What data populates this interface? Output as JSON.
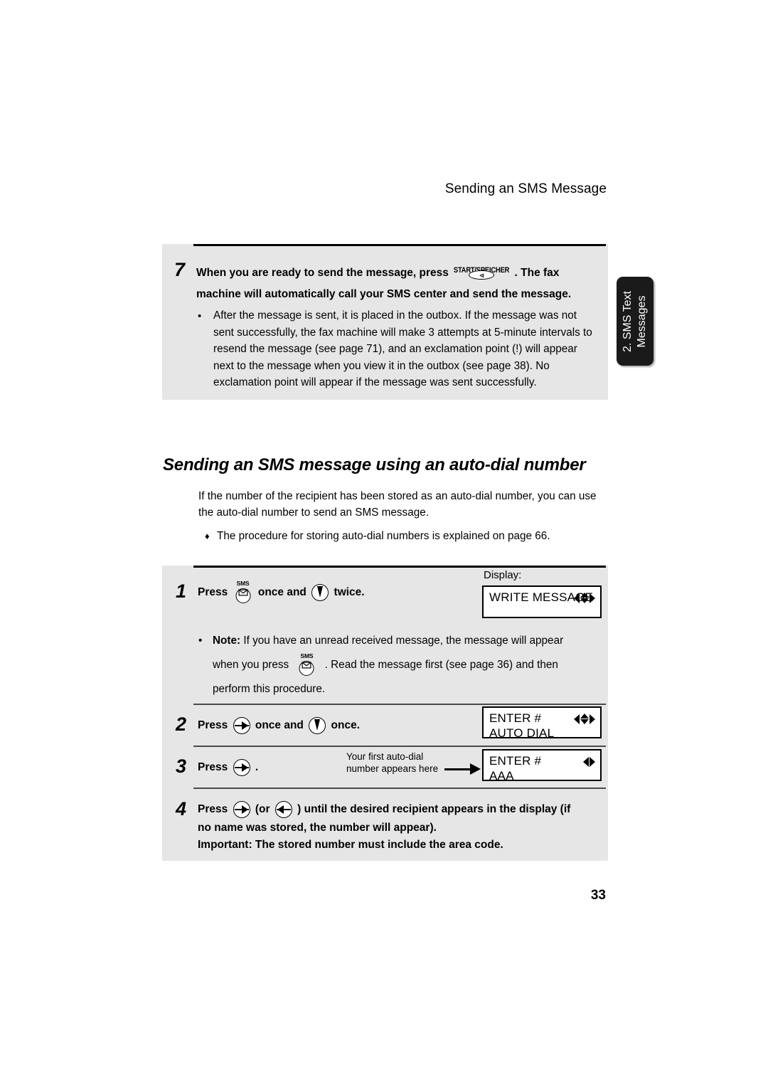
{
  "header": {
    "running_title": "Sending an SMS Message"
  },
  "side_tab": {
    "line1": "2. SMS Text",
    "line2": "Messages"
  },
  "step7": {
    "number": "7",
    "text_before_key": "When you are ready to send the message, press",
    "key_label": "START/SPEICHER",
    "text_after_key": ". The fax machine will automatically call your SMS center and send the message.",
    "bullet": "After the message is sent, it is placed in the outbox. If the message was not sent successfully, the fax machine will make 3 attempts at 5-minute intervals to resend the message (see page 71), and an exclamation point (!) will appear next to the message when you view it in the outbox (see page 38). No exclamation point will appear if the message was sent successfully.",
    "bullet_marker": "•"
  },
  "section": {
    "heading": "Sending an SMS message using an auto-dial number",
    "intro": "If the number of the recipient has been stored as an auto-dial number, you can use the auto-dial number to send an SMS message.",
    "diamond_marker": "♦",
    "diamond_note": "The procedure for storing auto-dial numbers is explained on page 66."
  },
  "display": {
    "label": "Display:"
  },
  "steps": [
    {
      "number": "1",
      "press_label": "Press",
      "mid_label": "once and",
      "end_label": "twice.",
      "icon1": "sms-key-icon",
      "icon2": "down-arrow-key-icon",
      "lcd": {
        "line1": "WRITE MESSAGE",
        "line2": "",
        "arrows": "left-right-updown"
      }
    },
    {
      "number": "2",
      "press_label": "Press",
      "mid_label": "once and",
      "end_label": "once.",
      "icon1": "right-arrow-key-icon",
      "icon2": "down-arrow-key-icon",
      "lcd": {
        "line1": "ENTER #",
        "line2": "AUTO DIAL",
        "arrows": "left-right-updown"
      }
    },
    {
      "number": "3",
      "press_label": "Press",
      "end_label": ".",
      "icon1": "right-arrow-key-icon",
      "callout_line1": "Your first auto-dial",
      "callout_line2": "number appears here",
      "lcd": {
        "line1": "ENTER #",
        "line2": "AAA",
        "arrows": "left-right"
      }
    },
    {
      "number": "4",
      "press_label": "Press",
      "or_open": "(or",
      "or_close": ")",
      "icon1": "right-arrow-key-icon",
      "icon2": "left-arrow-key-icon",
      "line1_tail": "until the desired recipient appears in the display (if",
      "line2": "no name was stored, the number will appear).",
      "line3": "Important: The stored number must include the area code."
    }
  ],
  "note": {
    "bullet_marker": "•",
    "label": "Note:",
    "text_part1": "If you have an unread received message, the message will appear",
    "text_part2": "when you press",
    "icon": "sms-key-icon",
    "text_part3": ". Read the message first (see page 36) and then",
    "text_part4": "perform this procedure."
  },
  "footer": {
    "page_number": "33"
  }
}
